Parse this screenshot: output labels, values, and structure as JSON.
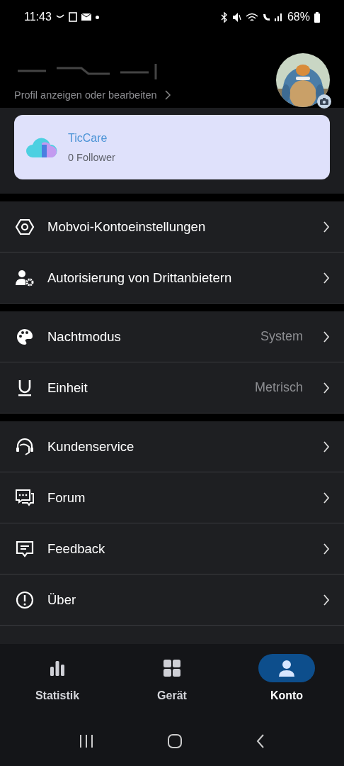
{
  "status_bar": {
    "time": "11:43",
    "battery": "68%"
  },
  "profile": {
    "subtitle": "Profil anzeigen oder bearbeiten"
  },
  "app_card": {
    "name": "TicCare",
    "followers": "0 Follower"
  },
  "sections": [
    {
      "items": [
        {
          "kind": "hexagon",
          "label": "Mobvoi-Kontoeinstellungen"
        },
        {
          "kind": "user-gear",
          "label": "Autorisierung von Drittanbietern"
        }
      ]
    },
    {
      "items": [
        {
          "kind": "palette",
          "label": "Nachtmodus",
          "value": "System"
        },
        {
          "kind": "underline",
          "label": "Einheit",
          "value": "Metrisch"
        }
      ]
    },
    {
      "items": [
        {
          "kind": "headset",
          "label": "Kundenservice"
        },
        {
          "kind": "chat",
          "label": "Forum"
        },
        {
          "kind": "feedback",
          "label": "Feedback"
        },
        {
          "kind": "info",
          "label": "Über"
        }
      ]
    }
  ],
  "bottom_nav": [
    {
      "kind": "bars",
      "label": "Statistik",
      "selected": false
    },
    {
      "kind": "grid",
      "label": "Gerät",
      "selected": false
    },
    {
      "kind": "person",
      "label": "Konto",
      "selected": true
    }
  ]
}
